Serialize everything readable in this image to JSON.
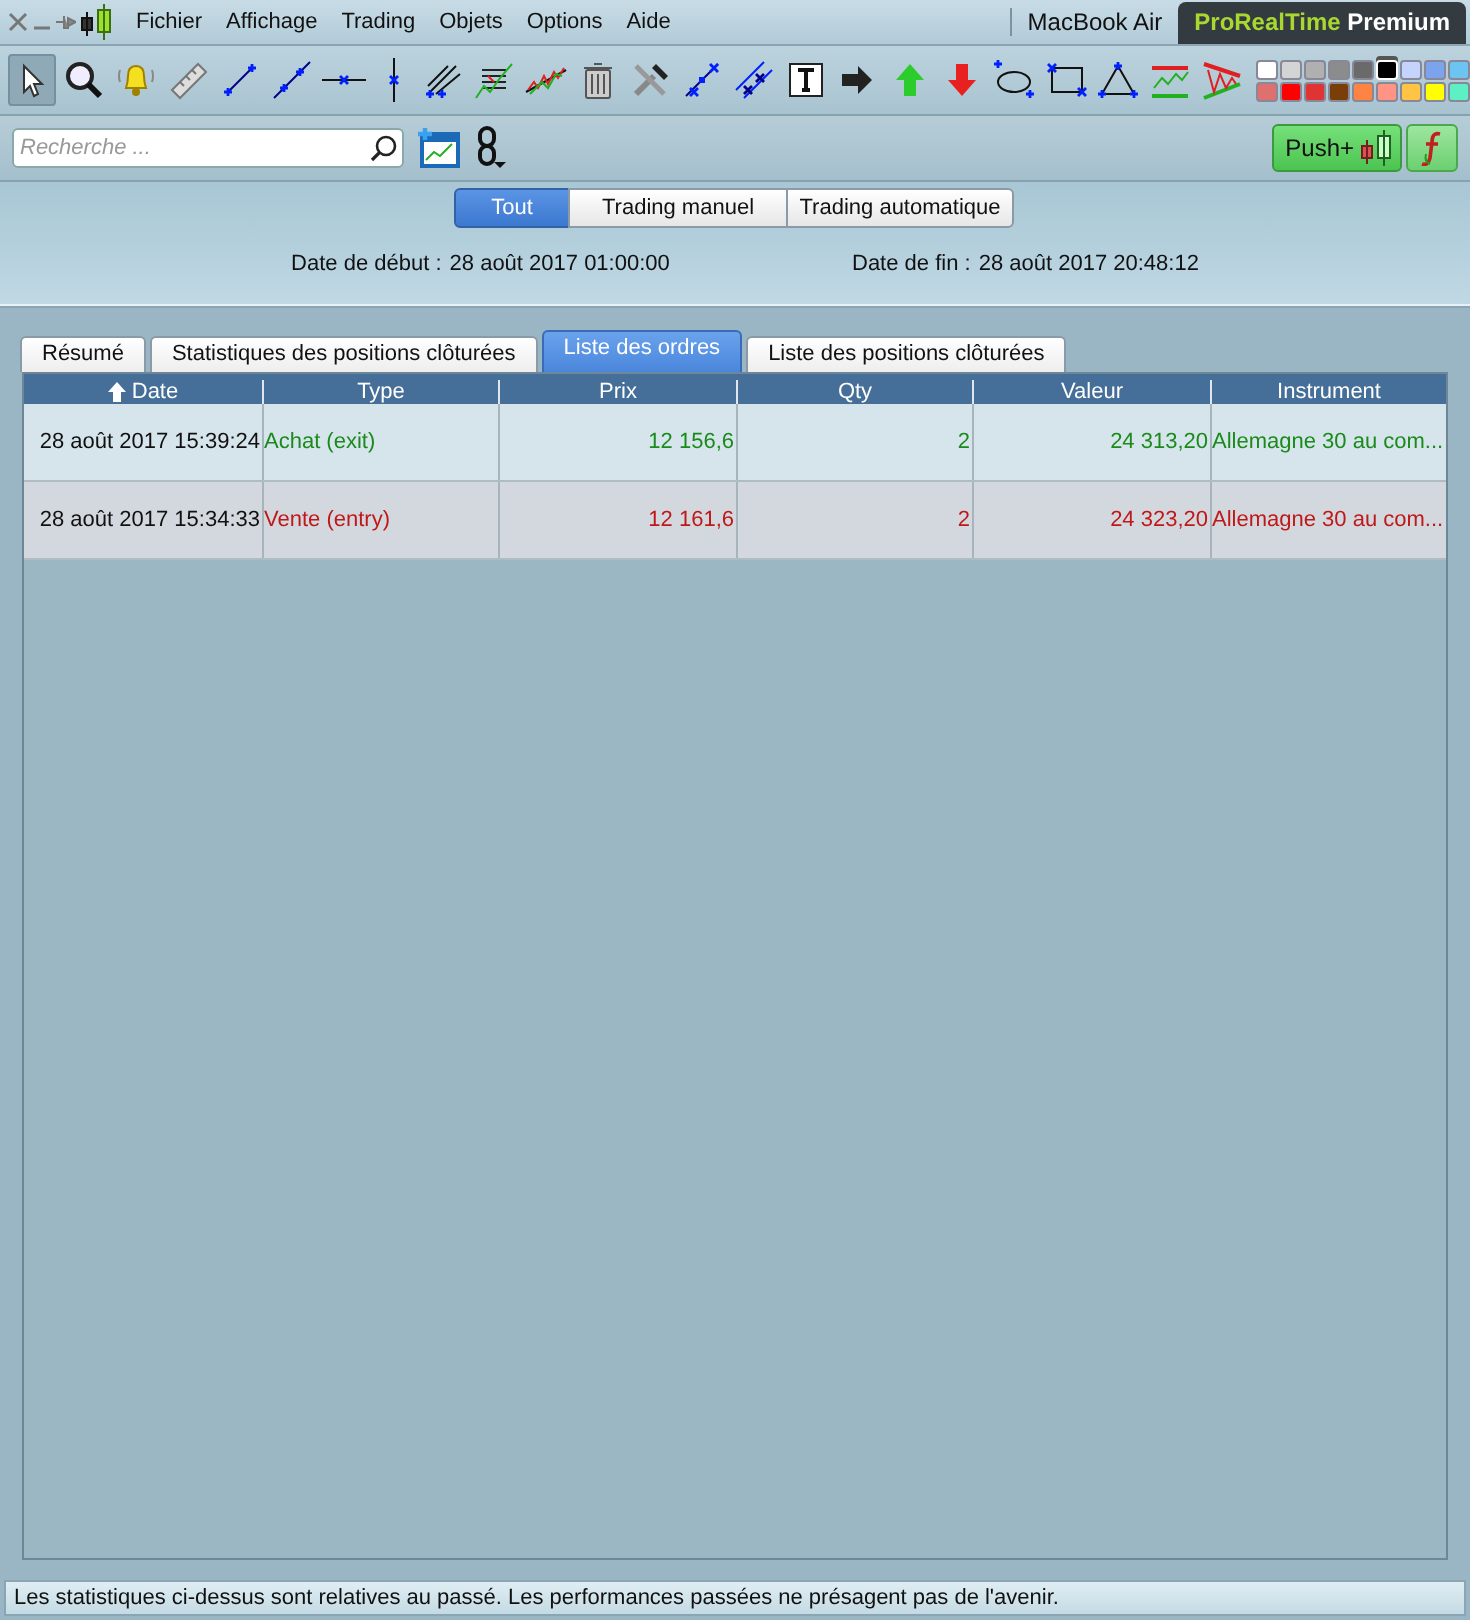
{
  "menu": [
    {
      "label": "Fichier"
    },
    {
      "label": "Affichage"
    },
    {
      "label": "Trading"
    },
    {
      "label": "Objets"
    },
    {
      "label": "Options"
    },
    {
      "label": "Aide"
    }
  ],
  "device": "MacBook Air",
  "brand": {
    "name": "ProRealTime",
    "edition": "Premium"
  },
  "drawing_tools": [
    {
      "kind": "pointer",
      "selected": true
    },
    {
      "kind": "zoom",
      "selected": false
    },
    {
      "kind": "alert",
      "selected": false
    },
    {
      "kind": "ruler",
      "selected": false
    },
    {
      "kind": "segment",
      "selected": false
    },
    {
      "kind": "line",
      "selected": false
    },
    {
      "kind": "hline",
      "selected": false
    },
    {
      "kind": "vline",
      "selected": false
    },
    {
      "kind": "fan",
      "selected": false
    },
    {
      "kind": "fibo",
      "selected": false
    },
    {
      "kind": "regression",
      "selected": false
    },
    {
      "kind": "trash",
      "selected": false
    },
    {
      "kind": "tools",
      "selected": false
    },
    {
      "kind": "dotline",
      "selected": false
    },
    {
      "kind": "parallel",
      "selected": false
    },
    {
      "kind": "text",
      "selected": false
    },
    {
      "kind": "arrow",
      "selected": false
    },
    {
      "kind": "up",
      "selected": false
    },
    {
      "kind": "down",
      "selected": false
    },
    {
      "kind": "ellipse",
      "selected": false
    },
    {
      "kind": "rect",
      "selected": false
    },
    {
      "kind": "triangle",
      "selected": false
    },
    {
      "kind": "channel",
      "selected": false
    },
    {
      "kind": "wedge",
      "selected": false
    }
  ],
  "palette": [
    {
      "color": "#ffffff",
      "selected": false
    },
    {
      "color": "#d4d4d4",
      "selected": false
    },
    {
      "color": "#b0b0b0",
      "selected": false
    },
    {
      "color": "#8c8c8c",
      "selected": false
    },
    {
      "color": "#6a6a6a",
      "selected": false
    },
    {
      "color": "#000000",
      "selected": true
    },
    {
      "color": "#c4d4fc",
      "selected": false
    },
    {
      "color": "#7ca4ee",
      "selected": false
    },
    {
      "color": "#6cc4f2",
      "selected": false
    },
    {
      "color": "#de7070",
      "selected": false
    },
    {
      "color": "#ff0000",
      "selected": false
    },
    {
      "color": "#e03434",
      "selected": false
    },
    {
      "color": "#7a3e08",
      "selected": false
    },
    {
      "color": "#ff8444",
      "selected": false
    },
    {
      "color": "#ff9484",
      "selected": false
    },
    {
      "color": "#ffc444",
      "selected": false
    },
    {
      "color": "#ffff00",
      "selected": false
    },
    {
      "color": "#5cf0c4",
      "selected": false
    }
  ],
  "search": {
    "placeholder": "Recherche ..."
  },
  "push_button": "Push+",
  "filters": [
    {
      "label": "Tout",
      "selected": true
    },
    {
      "label": "Trading manuel",
      "selected": false
    },
    {
      "label": "Trading automatique",
      "selected": false
    }
  ],
  "start_date": {
    "label": "Date de début :",
    "value": "28 août 2017 01:00:00"
  },
  "end_date": {
    "label": "Date de fin :",
    "value": "28 août 2017 20:48:12"
  },
  "tabs": [
    {
      "label": "Résumé",
      "selected": false
    },
    {
      "label": "Statistiques des positions clôturées",
      "selected": false
    },
    {
      "label": "Liste des ordres",
      "selected": true
    },
    {
      "label": "Liste des positions clôturées",
      "selected": false
    }
  ],
  "table": {
    "columns": [
      {
        "label": "Date",
        "sorted": true
      },
      {
        "label": "Type",
        "sorted": false
      },
      {
        "label": "Prix",
        "sorted": false
      },
      {
        "label": "Qty",
        "sorted": false
      },
      {
        "label": "Valeur",
        "sorted": false
      },
      {
        "label": "Instrument",
        "sorted": false
      }
    ],
    "rows": [
      {
        "kind": "buy",
        "cells": [
          "28 août 2017 15:39:24",
          "Achat (exit)",
          "12 156,6",
          "2",
          "24 313,20",
          "Allemagne 30 au com..."
        ]
      },
      {
        "kind": "sell",
        "cells": [
          "28 août 2017 15:34:33",
          "Vente (entry)",
          "12 161,6",
          "2",
          "24 323,20",
          "Allemagne 30 au com..."
        ]
      }
    ]
  },
  "status_bar": "Les statistiques ci-dessus sont relatives au passé. Les performances passées ne présagent pas de l'avenir."
}
